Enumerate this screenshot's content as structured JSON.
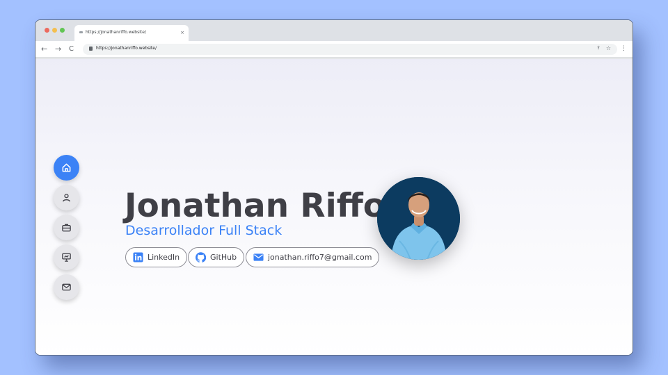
{
  "browser": {
    "tab_title": "https://jonathanriffo.website/",
    "tab_close": "×",
    "back": "←",
    "forward": "→",
    "reload": "C",
    "address": "https://jonathanriffo.website/",
    "share": "⇪",
    "bookmark": "☆",
    "menu": "⋮"
  },
  "sidebar": {
    "items": [
      {
        "name": "home",
        "icon": "home-icon",
        "active": true
      },
      {
        "name": "about",
        "icon": "user-icon",
        "active": false
      },
      {
        "name": "experience",
        "icon": "briefcase-icon",
        "active": false
      },
      {
        "name": "projects",
        "icon": "presentation-icon",
        "active": false
      },
      {
        "name": "contact",
        "icon": "mail-icon",
        "active": false
      }
    ]
  },
  "hero": {
    "name": "Jonathan Riffo",
    "role": "Desarrollador Full Stack",
    "links": [
      {
        "label": "LinkedIn",
        "icon": "linkedin-icon"
      },
      {
        "label": "GitHub",
        "icon": "github-icon"
      },
      {
        "label": "jonathan.riffo7@gmail.com",
        "icon": "mail-icon"
      }
    ]
  },
  "colors": {
    "accent": "#3b82f6",
    "text": "#3f3f46",
    "background": "#a3c1ff"
  }
}
